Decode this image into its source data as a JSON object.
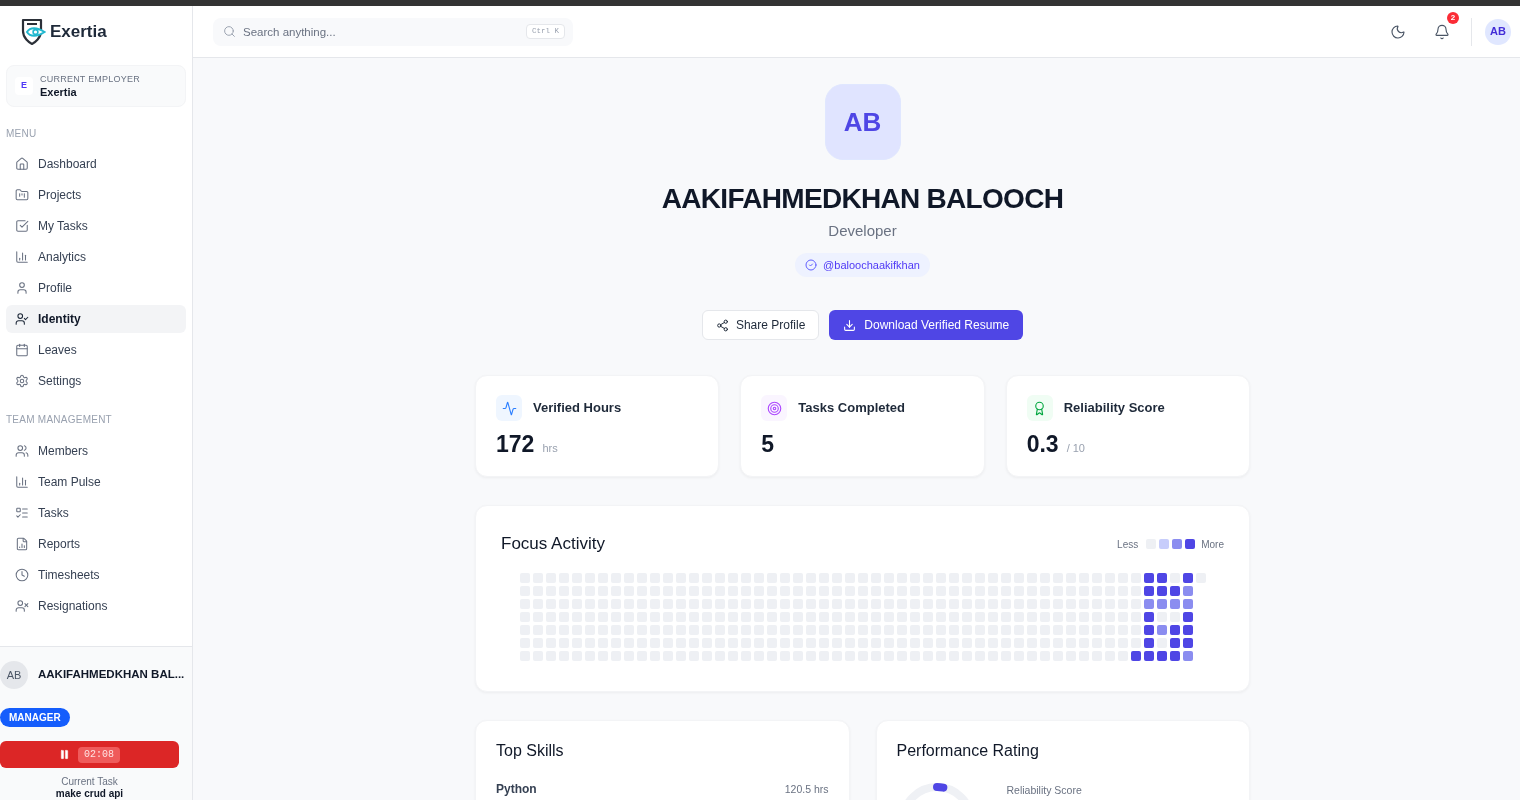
{
  "sidebar": {
    "brand": "Exertia",
    "employer": {
      "initial": "E",
      "label": "CURRENT EMPLOYER",
      "name": "Exertia"
    },
    "sections": [
      {
        "title": "MENU",
        "items": [
          {
            "label": "Dashboard",
            "selected": false
          },
          {
            "label": "Projects",
            "selected": false
          },
          {
            "label": "My Tasks",
            "selected": false
          },
          {
            "label": "Analytics",
            "selected": false
          },
          {
            "label": "Profile",
            "selected": false
          },
          {
            "label": "Identity",
            "selected": true
          },
          {
            "label": "Leaves",
            "selected": false
          },
          {
            "label": "Settings",
            "selected": false
          }
        ]
      },
      {
        "title": "TEAM MANAGEMENT",
        "items": [
          {
            "label": "Members",
            "selected": false
          },
          {
            "label": "Team Pulse",
            "selected": false
          },
          {
            "label": "Tasks",
            "selected": false
          },
          {
            "label": "Reports",
            "selected": false
          },
          {
            "label": "Timesheets",
            "selected": false
          },
          {
            "label": "Resignations",
            "selected": false
          }
        ]
      }
    ],
    "user": {
      "initials": "AB",
      "name": "AAKIFAHMEDKHAN BAL...",
      "role": "MANAGER"
    },
    "timer": {
      "time": "02:08",
      "running": true
    },
    "current_task": {
      "label": "Current Task",
      "name": "make crud api"
    }
  },
  "topbar": {
    "search": {
      "placeholder": "Search anything...",
      "shortcut": "Ctrl K"
    },
    "notifications": "2",
    "avatar": "AB"
  },
  "profile": {
    "initials": "AB",
    "name": "AAKIFAHMEDKHAN BALOOCH",
    "role": "Developer",
    "handle": "@baloochaakifkhan"
  },
  "actions": [
    {
      "label": "Share Profile",
      "kind": "secondary"
    },
    {
      "label": "Download Verified Resume",
      "kind": "primary"
    }
  ],
  "stats": [
    {
      "title": "Verified Hours",
      "value": "172",
      "unit": "hrs"
    },
    {
      "title": "Tasks Completed",
      "value": "5"
    },
    {
      "title": "Reliability Score",
      "value": "0.3",
      "unit": "/ 10"
    }
  ],
  "focus_activity": {
    "title": "Focus Activity",
    "legend": {
      "less": "Less",
      "more": "More",
      "swatches": [
        {
          "color": "#eef0f4"
        },
        {
          "color": "#c7cdfb"
        },
        {
          "color": "#8b8df0"
        },
        {
          "color": "#4f46e5"
        }
      ]
    }
  },
  "top_skills": {
    "title": "Top Skills",
    "skills": [
      {
        "name": "Python",
        "hours": "120.5 hrs"
      }
    ]
  },
  "performance_rating": {
    "title": "Performance Rating",
    "gauge": {
      "level": 0.03
    },
    "label": "Reliability Score"
  }
}
